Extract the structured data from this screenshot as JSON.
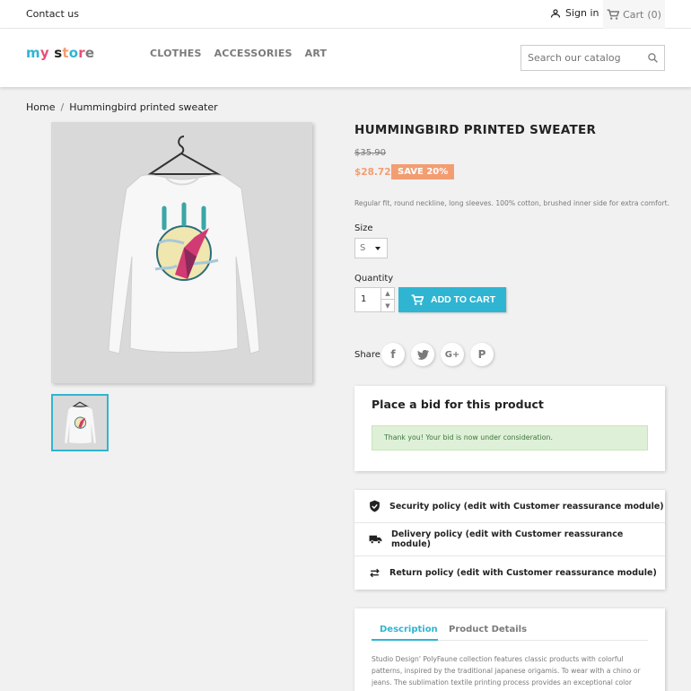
{
  "topbar": {
    "contact": "Contact us",
    "signin": "Sign in",
    "cart": "Cart",
    "cart_count": "(0)"
  },
  "header": {
    "logo": [
      "m",
      "y",
      " ",
      "s",
      "t",
      "o",
      "r",
      "e"
    ],
    "nav": [
      "CLOTHES",
      "ACCESSORIES",
      "ART"
    ],
    "search_placeholder": "Search our catalog"
  },
  "breadcrumb": {
    "home": "Home",
    "current": "Hummingbird printed sweater"
  },
  "product": {
    "title": "HUMMINGBIRD PRINTED SWEATER",
    "old_price": "$35.90",
    "price": "$28.72",
    "discount": "SAVE 20%",
    "short_description": "Regular fit, round neckline, long sleeves. 100% cotton, brushed inner side for extra comfort.",
    "size_label": "Size",
    "size_value": "S",
    "quantity_label": "Quantity",
    "quantity_value": "1",
    "add_to_cart": "ADD TO CART",
    "share_label": "Share"
  },
  "bid": {
    "title": "Place a bid for this product",
    "message": "Thank you! Your bid is now under consideration."
  },
  "reassurance": [
    "Security policy (edit with Customer reassurance module)",
    "Delivery policy (edit with Customer reassurance module)",
    "Return policy (edit with Customer reassurance module)"
  ],
  "tabs": {
    "description": "Description",
    "details": "Product Details",
    "description_text": "Studio Design' PolyFaune collection features classic products with colorful patterns, inspired by the traditional japanese origamis. To wear with a chino or jeans. The sublimation textile printing process provides an exceptional color"
  },
  "colors": {
    "accent": "#2fb5d2",
    "discount": "#f39d72",
    "success_bg": "#dff0d8",
    "logo": [
      "#2fb5d2",
      "#e94e77",
      "#232323",
      "#232323",
      "#f39d72",
      "#2fb5d2",
      "#e94e77",
      "#7a7a7a"
    ]
  }
}
